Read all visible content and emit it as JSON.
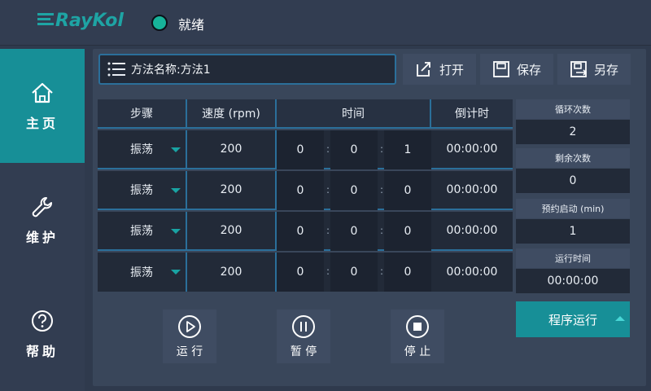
{
  "header": {
    "logo_text": "RayKol",
    "status_text": "就绪",
    "status_color": "#17b39a"
  },
  "sidebar": {
    "items": [
      {
        "label": "主页",
        "icon": "home-icon",
        "active": true
      },
      {
        "label": "维护",
        "icon": "wrench-icon",
        "active": false
      },
      {
        "label": "帮助",
        "icon": "help-icon",
        "active": false
      }
    ]
  },
  "method": {
    "label": "方法名称:方法1",
    "icon": "list-icon"
  },
  "toolbar": {
    "open_label": "打开",
    "save_label": "保存",
    "save_as_label": "另存"
  },
  "table": {
    "headers": [
      "步骤",
      "速度 (rpm)",
      "时间",
      "倒计时"
    ],
    "rows": [
      {
        "step": "振荡",
        "speed": "200",
        "h": "0",
        "m": "0",
        "s": "1",
        "countdown": "00:00:00"
      },
      {
        "step": "振荡",
        "speed": "200",
        "h": "0",
        "m": "0",
        "s": "0",
        "countdown": "00:00:00"
      },
      {
        "step": "振荡",
        "speed": "200",
        "h": "0",
        "m": "0",
        "s": "0",
        "countdown": "00:00:00"
      },
      {
        "step": "振荡",
        "speed": "200",
        "h": "0",
        "m": "0",
        "s": "0",
        "countdown": "00:00:00"
      }
    ],
    "separator": ":"
  },
  "info": {
    "cycle_label": "循环次数",
    "cycle_value": "2",
    "remaining_label": "剩余次数",
    "remaining_value": "0",
    "delay_label": "预约启动 (min)",
    "delay_value": "1",
    "runtime_label": "运行时间",
    "runtime_value": "00:00:00"
  },
  "controls": {
    "run_label": "运 行",
    "pause_label": "暂 停",
    "stop_label": "停 止",
    "program_run_label": "程序运行"
  },
  "colors": {
    "accent": "#178f97",
    "border": "#2b6f9a",
    "panel": "#39465a"
  }
}
